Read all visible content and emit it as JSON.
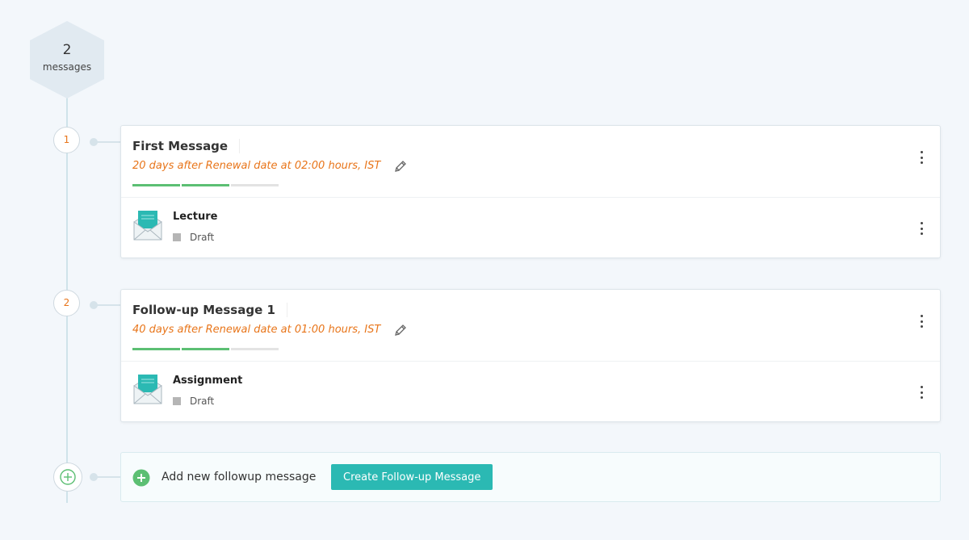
{
  "summary": {
    "count": "2",
    "label": "messages"
  },
  "messages": [
    {
      "step": "1",
      "title": "First Message",
      "schedule": "20  days after Renewal date at  02:00 hours, IST",
      "progress_done": 2,
      "progress_total": 3,
      "item": {
        "name": "Lecture",
        "status": "Draft"
      }
    },
    {
      "step": "2",
      "title": "Follow-up Message 1",
      "schedule": "40  days after Renewal date at  01:00 hours, IST",
      "progress_done": 2,
      "progress_total": 3,
      "item": {
        "name": "Assignment",
        "status": "Draft"
      }
    }
  ],
  "add": {
    "label": "Add new followup message",
    "button_label": "Create Follow-up Message"
  },
  "colors": {
    "accent_orange": "#e8751a",
    "progress_green": "#5cbf73",
    "button_teal": "#2bb9b3",
    "envelope_teal": "#2bb9b3"
  },
  "icons": [
    "edit-pencil-icon",
    "kebab-menu-icon",
    "envelope-open-icon",
    "plus-circle-icon"
  ]
}
